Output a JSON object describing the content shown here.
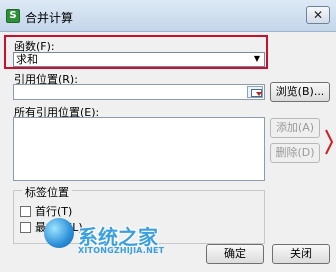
{
  "window": {
    "title": "合并计算",
    "app_icon_glyph": "S",
    "close_glyph": "✕"
  },
  "function_field": {
    "label": "函数(F):",
    "value": "求和",
    "dropdown_glyph": "▼"
  },
  "reference_field": {
    "label": "引用位置(R):",
    "value": ""
  },
  "buttons": {
    "browse": "浏览(B)...",
    "add": "添加(A)",
    "delete": "删除(D)",
    "ok": "确定",
    "close": "关闭"
  },
  "all_references": {
    "label": "所有引用位置(E):",
    "items": []
  },
  "label_position": {
    "title": "标签位置",
    "first_row": "首行(T)",
    "left_column": "最左列(L)"
  },
  "watermark": {
    "text": "系统之家",
    "subtext": "XITONGZHIJIA.NET"
  },
  "colors": {
    "highlight_border": "#c8102e",
    "watermark": "#3aa0e0"
  },
  "icons": {
    "app": "wps-spreadsheet-icon",
    "close": "close-icon",
    "dropdown": "chevron-down-icon",
    "collapse": "collapse-dialog-icon"
  }
}
